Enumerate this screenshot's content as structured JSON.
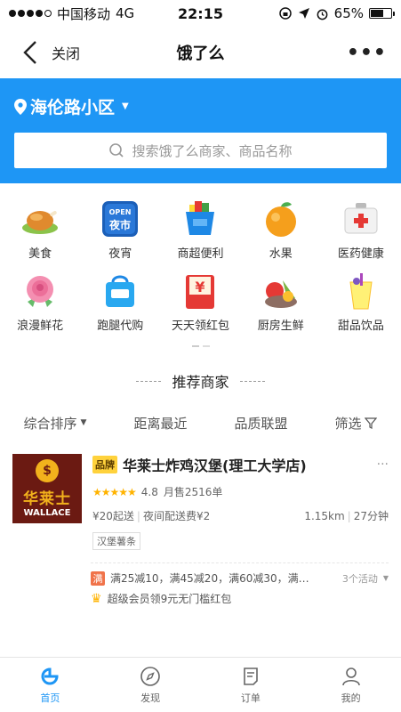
{
  "status": {
    "carrier": "中国移动",
    "network": "4G",
    "time": "22:15",
    "battery": "65%",
    "battery_level": 0.65
  },
  "nav": {
    "close_label": "关闭",
    "title": "饿了么",
    "more": "•••"
  },
  "location": {
    "name": "海伦路小区"
  },
  "search": {
    "placeholder": "搜索饿了么商家、商品名称"
  },
  "categories": [
    {
      "label": "美食",
      "icon": "roast-chicken-icon"
    },
    {
      "label": "夜宵",
      "icon": "night-market-icon",
      "icon_top": "OPEN",
      "icon_text": "夜市"
    },
    {
      "label": "商超便利",
      "icon": "shopping-basket-icon"
    },
    {
      "label": "水果",
      "icon": "orange-icon"
    },
    {
      "label": "医药健康",
      "icon": "medicine-box-icon"
    },
    {
      "label": "浪漫鲜花",
      "icon": "rose-icon"
    },
    {
      "label": "跑腿代购",
      "icon": "errand-bag-icon"
    },
    {
      "label": "天天领红包",
      "icon": "red-envelope-icon",
      "icon_text": "¥"
    },
    {
      "label": "厨房生鲜",
      "icon": "vegetables-icon"
    },
    {
      "label": "甜品饮品",
      "icon": "drink-cup-icon"
    }
  ],
  "recommend": {
    "title": "推荐商家"
  },
  "filters": {
    "sort": "综合排序",
    "distance": "距离最近",
    "quality": "品质联盟",
    "filter": "筛选"
  },
  "shop": {
    "logo_cn": "华莱士",
    "logo_en": "WALLACE",
    "logo_symbol": "$",
    "brand_badge": "品牌",
    "name": "华莱士炸鸡汉堡(理工大学店)",
    "more": "···",
    "stars": "★★★★★",
    "rating": "4.8",
    "monthly_sales": "月售2516单",
    "min_order": "¥20起送",
    "delivery_fee": "夜间配送费¥2",
    "distance": "1.15km",
    "time": "27分钟",
    "tag": "汉堡薯条",
    "activity_badge": "满",
    "activity_text": "满25减10，满45减20，满60减30，满…",
    "activity_count": "3个活动",
    "vip_text": "超级会员领9元无门槛红包"
  },
  "tabs": [
    {
      "label": "首页",
      "icon": "home-icon",
      "active": true
    },
    {
      "label": "发现",
      "icon": "compass-icon",
      "active": false
    },
    {
      "label": "订单",
      "icon": "order-icon",
      "active": false
    },
    {
      "label": "我的",
      "icon": "profile-icon",
      "active": false
    }
  ],
  "colors": {
    "brand_blue": "#1e96f5",
    "star": "#ffb300",
    "activity": "#f0734a"
  }
}
